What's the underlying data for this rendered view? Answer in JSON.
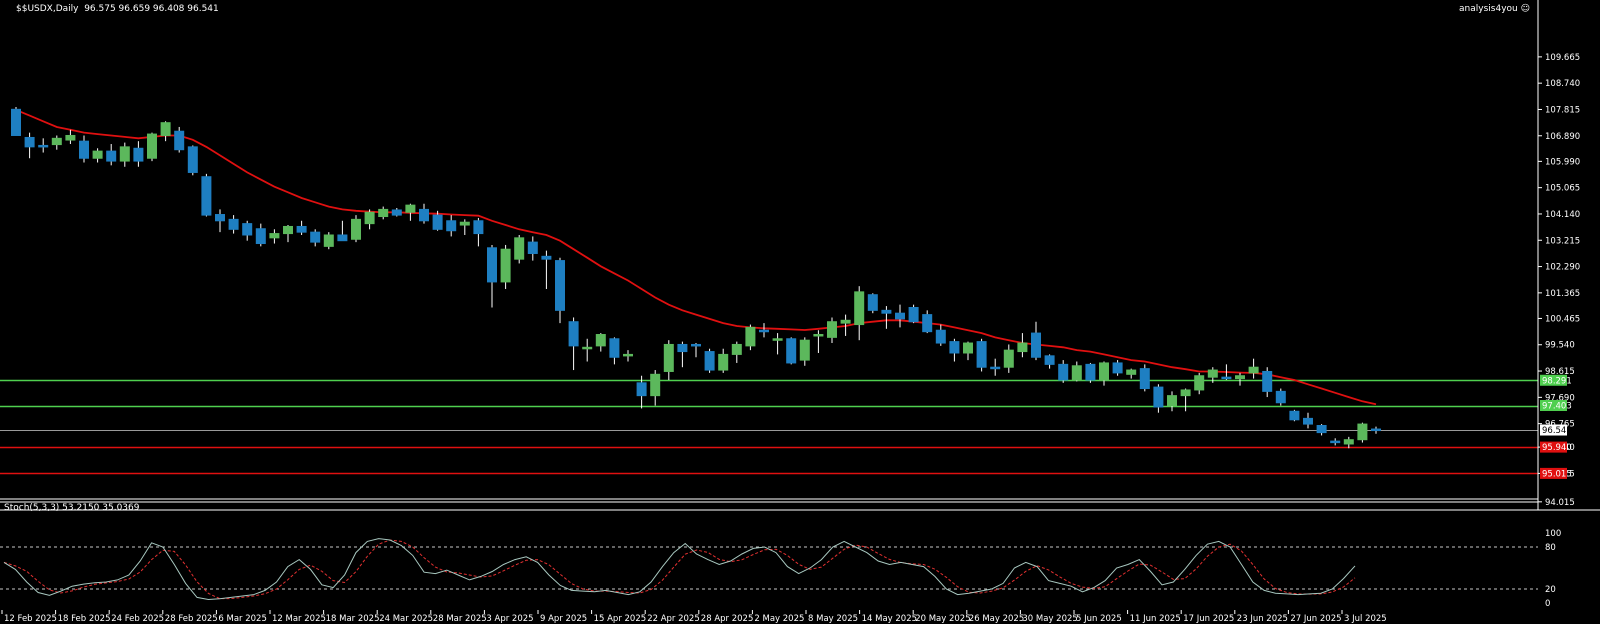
{
  "header": {
    "symbol_line": "$$USDX,Daily  96.575 96.659 96.408 96.541",
    "branding": "analysis4you"
  },
  "colors": {
    "background": "#000000",
    "bull_candle": "#5cb85c",
    "bear_candle": "#1e7fc2",
    "ma_line": "#e01010",
    "resistance_lines": "#4fcf4f",
    "support_lines": "#e01010",
    "current_price_line": "#9a9a9a",
    "stoch_main": "#a8c8c0",
    "stoch_signal": "#e03030",
    "axis_text": "#ffffff"
  },
  "price_axis": {
    "ticks": [
      "109.665",
      "108.740",
      "107.815",
      "106.890",
      "105.990",
      "105.065",
      "104.140",
      "103.215",
      "102.290",
      "101.365",
      "100.465",
      "99.540",
      "98.615",
      "97.690",
      "96.765",
      "95.940",
      "95.015",
      "94.015"
    ]
  },
  "price_tags": [
    {
      "label": "98.291",
      "kind": "resistance"
    },
    {
      "label": "97.403",
      "kind": "resistance"
    },
    {
      "label": "96.541",
      "kind": "current"
    },
    {
      "label": "95.940",
      "kind": "support"
    },
    {
      "label": "95.015",
      "kind": "support"
    }
  ],
  "date_axis": {
    "labels": [
      "12 Feb 2025",
      "18 Feb 2025",
      "24 Feb 2025",
      "28 Feb 2025",
      "6 Mar 2025",
      "12 Mar 2025",
      "18 Mar 2025",
      "24 Mar 2025",
      "28 Mar 2025",
      "3 Apr 2025",
      "9 Apr 2025",
      "15 Apr 2025",
      "22 Apr 2025",
      "28 Apr 2025",
      "2 May 2025",
      "8 May 2025",
      "14 May 2025",
      "20 May 2025",
      "26 May 2025",
      "30 May 2025",
      "5 Jun 2025",
      "11 Jun 2025",
      "17 Jun 2025",
      "23 Jun 2025",
      "27 Jun 2025",
      "3 Jul 2025"
    ]
  },
  "stoch_panel": {
    "title": "Stoch(5,3,3) 53.2150 35.0369",
    "ticks": [
      "100",
      "80",
      "20",
      "0"
    ]
  },
  "chart_data": {
    "type": "candlestick",
    "title": "$$USDX,Daily",
    "ohlc_last": {
      "open": 96.575,
      "high": 96.659,
      "low": 96.408,
      "close": 96.541
    },
    "ylim": [
      94.0,
      110.1
    ],
    "horizontal_levels": [
      {
        "value": 98.291,
        "kind": "resistance"
      },
      {
        "value": 97.403,
        "kind": "resistance"
      },
      {
        "value": 96.541,
        "kind": "current"
      },
      {
        "value": 95.94,
        "kind": "support"
      },
      {
        "value": 95.015,
        "kind": "support"
      }
    ],
    "candles": [
      [
        107.82,
        107.9,
        106.9,
        106.9
      ],
      [
        106.83,
        107.0,
        106.1,
        106.5
      ],
      [
        106.55,
        106.8,
        106.3,
        106.5
      ],
      [
        106.58,
        106.9,
        106.4,
        106.8
      ],
      [
        106.74,
        107.1,
        106.6,
        106.9
      ],
      [
        106.7,
        106.9,
        105.95,
        106.1
      ],
      [
        106.1,
        106.45,
        105.95,
        106.35
      ],
      [
        106.35,
        106.6,
        105.85,
        106.0
      ],
      [
        106.0,
        106.65,
        105.8,
        106.5
      ],
      [
        106.45,
        106.7,
        105.8,
        106.0
      ],
      [
        106.1,
        107.0,
        106.0,
        106.95
      ],
      [
        106.9,
        107.4,
        106.7,
        107.35
      ],
      [
        107.05,
        107.2,
        106.3,
        106.4
      ],
      [
        106.5,
        106.55,
        105.5,
        105.6
      ],
      [
        105.45,
        105.55,
        104.05,
        104.1
      ],
      [
        104.12,
        104.3,
        103.5,
        103.9
      ],
      [
        103.95,
        104.1,
        103.45,
        103.6
      ],
      [
        103.8,
        103.9,
        103.2,
        103.4
      ],
      [
        103.62,
        103.8,
        103.0,
        103.1
      ],
      [
        103.3,
        103.6,
        103.1,
        103.45
      ],
      [
        103.45,
        103.75,
        103.15,
        103.7
      ],
      [
        103.7,
        103.9,
        103.4,
        103.5
      ],
      [
        103.5,
        103.6,
        103.0,
        103.15
      ],
      [
        103.0,
        103.5,
        102.9,
        103.4
      ],
      [
        103.4,
        103.9,
        103.2,
        103.2
      ],
      [
        103.25,
        104.1,
        103.15,
        103.95
      ],
      [
        103.8,
        104.3,
        103.6,
        104.2
      ],
      [
        104.05,
        104.4,
        103.95,
        104.3
      ],
      [
        104.28,
        104.35,
        104.05,
        104.1
      ],
      [
        104.2,
        104.5,
        103.9,
        104.45
      ],
      [
        104.3,
        104.5,
        103.8,
        103.9
      ],
      [
        104.1,
        104.25,
        103.55,
        103.6
      ],
      [
        103.9,
        104.1,
        103.35,
        103.55
      ],
      [
        103.75,
        103.95,
        103.4,
        103.85
      ],
      [
        103.9,
        104.0,
        103.0,
        103.45
      ],
      [
        102.95,
        103.05,
        100.85,
        101.75
      ],
      [
        101.75,
        103.05,
        101.5,
        102.9
      ],
      [
        102.55,
        103.4,
        102.4,
        103.3
      ],
      [
        103.15,
        103.35,
        102.5,
        102.75
      ],
      [
        102.65,
        102.85,
        101.5,
        102.55
      ],
      [
        102.5,
        102.6,
        100.3,
        100.75
      ],
      [
        100.35,
        100.5,
        98.65,
        99.5
      ],
      [
        99.4,
        99.75,
        98.95,
        99.45
      ],
      [
        99.5,
        99.95,
        99.3,
        99.9
      ],
      [
        99.75,
        99.8,
        98.85,
        99.1
      ],
      [
        99.2,
        99.35,
        98.95,
        99.2
      ],
      [
        98.2,
        98.45,
        97.3,
        97.75
      ],
      [
        97.75,
        98.65,
        97.4,
        98.5
      ],
      [
        98.6,
        99.7,
        98.3,
        99.55
      ],
      [
        99.55,
        99.65,
        98.75,
        99.3
      ],
      [
        99.55,
        99.6,
        99.1,
        99.5
      ],
      [
        99.3,
        99.4,
        98.55,
        98.65
      ],
      [
        98.65,
        99.4,
        98.55,
        99.2
      ],
      [
        99.2,
        99.65,
        98.9,
        99.55
      ],
      [
        99.5,
        100.25,
        99.35,
        100.15
      ],
      [
        100.05,
        100.3,
        99.8,
        100.0
      ],
      [
        99.75,
        99.95,
        99.2,
        99.75
      ],
      [
        99.75,
        99.8,
        98.85,
        98.9
      ],
      [
        99.0,
        99.8,
        98.8,
        99.7
      ],
      [
        99.85,
        100.05,
        99.25,
        99.9
      ],
      [
        99.8,
        100.5,
        99.6,
        100.35
      ],
      [
        100.3,
        100.6,
        99.85,
        100.4
      ],
      [
        100.25,
        101.6,
        99.7,
        101.4
      ],
      [
        101.3,
        101.35,
        100.65,
        100.75
      ],
      [
        100.75,
        100.9,
        100.1,
        100.65
      ],
      [
        100.65,
        100.95,
        100.15,
        100.45
      ],
      [
        100.85,
        100.95,
        100.3,
        100.35
      ],
      [
        100.6,
        100.75,
        99.95,
        100.0
      ],
      [
        100.05,
        100.25,
        99.5,
        99.6
      ],
      [
        99.65,
        99.75,
        98.95,
        99.25
      ],
      [
        99.25,
        99.65,
        99.0,
        99.6
      ],
      [
        99.65,
        99.75,
        98.6,
        98.75
      ],
      [
        98.75,
        99.05,
        98.45,
        98.7
      ],
      [
        98.75,
        99.55,
        98.55,
        99.35
      ],
      [
        99.3,
        99.95,
        99.1,
        99.6
      ],
      [
        99.95,
        100.35,
        99.0,
        99.1
      ],
      [
        99.15,
        99.2,
        98.7,
        98.85
      ],
      [
        98.85,
        99.0,
        98.2,
        98.3
      ],
      [
        98.3,
        98.95,
        98.25,
        98.8
      ],
      [
        98.85,
        98.9,
        98.2,
        98.3
      ],
      [
        98.3,
        98.95,
        98.1,
        98.9
      ],
      [
        98.9,
        99.0,
        98.45,
        98.55
      ],
      [
        98.5,
        98.7,
        98.35,
        98.65
      ],
      [
        98.7,
        98.85,
        97.9,
        98.0
      ],
      [
        98.05,
        98.15,
        97.15,
        97.35
      ],
      [
        97.4,
        97.9,
        97.2,
        97.75
      ],
      [
        97.75,
        98.0,
        97.2,
        97.95
      ],
      [
        97.95,
        98.55,
        97.8,
        98.45
      ],
      [
        98.4,
        98.75,
        98.2,
        98.65
      ],
      [
        98.4,
        98.85,
        98.3,
        98.35
      ],
      [
        98.35,
        98.55,
        98.1,
        98.45
      ],
      [
        98.55,
        99.05,
        98.35,
        98.75
      ],
      [
        98.6,
        98.75,
        97.7,
        97.9
      ],
      [
        97.9,
        98.0,
        97.4,
        97.5
      ],
      [
        97.2,
        97.25,
        96.85,
        96.9
      ],
      [
        96.95,
        97.15,
        96.6,
        96.75
      ],
      [
        96.7,
        96.75,
        96.35,
        96.45
      ],
      [
        96.15,
        96.25,
        96.0,
        96.1
      ],
      [
        96.05,
        96.3,
        95.9,
        96.2
      ],
      [
        96.2,
        96.8,
        96.1,
        96.75
      ],
      [
        96.575,
        96.659,
        96.408,
        96.541
      ]
    ],
    "ma": [
      107.8,
      107.6,
      107.4,
      107.2,
      107.1,
      107.0,
      106.95,
      106.9,
      106.85,
      106.8,
      106.85,
      106.9,
      106.9,
      106.75,
      106.5,
      106.2,
      105.9,
      105.6,
      105.35,
      105.1,
      104.9,
      104.7,
      104.55,
      104.4,
      104.3,
      104.25,
      104.22,
      104.2,
      104.2,
      104.18,
      104.16,
      104.15,
      104.12,
      104.1,
      104.08,
      103.9,
      103.75,
      103.6,
      103.5,
      103.4,
      103.2,
      102.9,
      102.6,
      102.3,
      102.05,
      101.8,
      101.5,
      101.2,
      100.95,
      100.75,
      100.6,
      100.45,
      100.3,
      100.2,
      100.15,
      100.12,
      100.1,
      100.08,
      100.06,
      100.1,
      100.15,
      100.2,
      100.3,
      100.35,
      100.4,
      100.4,
      100.35,
      100.3,
      100.25,
      100.15,
      100.05,
      99.95,
      99.8,
      99.7,
      99.6,
      99.55,
      99.5,
      99.45,
      99.35,
      99.3,
      99.2,
      99.1,
      99.0,
      98.95,
      98.85,
      98.75,
      98.68,
      98.6,
      98.6,
      98.58,
      98.56,
      98.55,
      98.5,
      98.4,
      98.3,
      98.15,
      98.0,
      97.85,
      97.7,
      97.55,
      97.45
    ]
  },
  "stoch_data": {
    "main": [
      58,
      48,
      30,
      15,
      11,
      17,
      24,
      27,
      29,
      30,
      33,
      40,
      60,
      86,
      80,
      55,
      28,
      8,
      5,
      6,
      8,
      10,
      12,
      18,
      30,
      52,
      62,
      48,
      26,
      22,
      40,
      72,
      88,
      92,
      90,
      82,
      68,
      44,
      42,
      47,
      40,
      33,
      38,
      45,
      55,
      62,
      66,
      58,
      40,
      25,
      18,
      17,
      16,
      18,
      15,
      12,
      16,
      30,
      52,
      72,
      85,
      70,
      62,
      55,
      60,
      70,
      78,
      80,
      72,
      52,
      42,
      50,
      62,
      80,
      88,
      80,
      72,
      60,
      55,
      58,
      55,
      52,
      38,
      20,
      12,
      14,
      17,
      20,
      28,
      50,
      58,
      52,
      32,
      28,
      24,
      16,
      22,
      32,
      50,
      55,
      62,
      45,
      26,
      30,
      48,
      68,
      84,
      88,
      80,
      55,
      30,
      18,
      14,
      13,
      12,
      13,
      14,
      20,
      35,
      53
    ]
  }
}
